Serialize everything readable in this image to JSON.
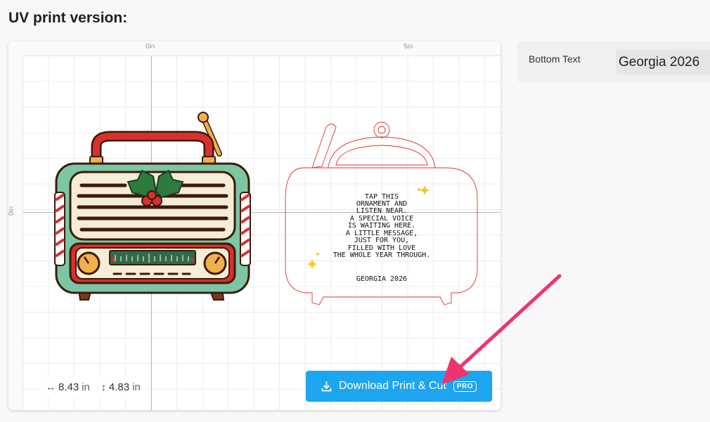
{
  "page": {
    "section_title": "UV print version:"
  },
  "canvas": {
    "ruler_top_labels": [
      "0in",
      "5in"
    ],
    "ruler_left_labels": [
      "0in"
    ],
    "dimensions": {
      "width_value": "8.43",
      "height_value": "4.83",
      "unit": "in",
      "width_icon": "horizontal-arrows-icon",
      "height_icon": "vertical-arrows-icon"
    },
    "ornament_text": [
      "TAP THIS",
      "ORNAMENT AND",
      "LISTEN NEAR.",
      "A SPECIAL VOICE",
      "IS WAITING HERE.",
      "A LITTLE MESSAGE,",
      "JUST FOR YOU,",
      "FILLED WITH LOVE",
      "THE WHOLE YEAR THROUGH."
    ],
    "ornament_bottom_text": "GEORGIA 2026",
    "download_button": {
      "label": "Download Print & Cut",
      "badge": "PRO",
      "icon": "download-icon",
      "color": "#1ea5ef"
    }
  },
  "side_panel": {
    "bottom_text_label": "Bottom Text",
    "bottom_text_value": "Georgia 2026"
  },
  "colors": {
    "cut_line": "#e0322b",
    "arrow": "#f0346e",
    "radio_body": "#7cc6a3",
    "radio_handle": "#d8302c",
    "radio_panel": "#f7ecd6",
    "sparkle": "#f5c518"
  }
}
